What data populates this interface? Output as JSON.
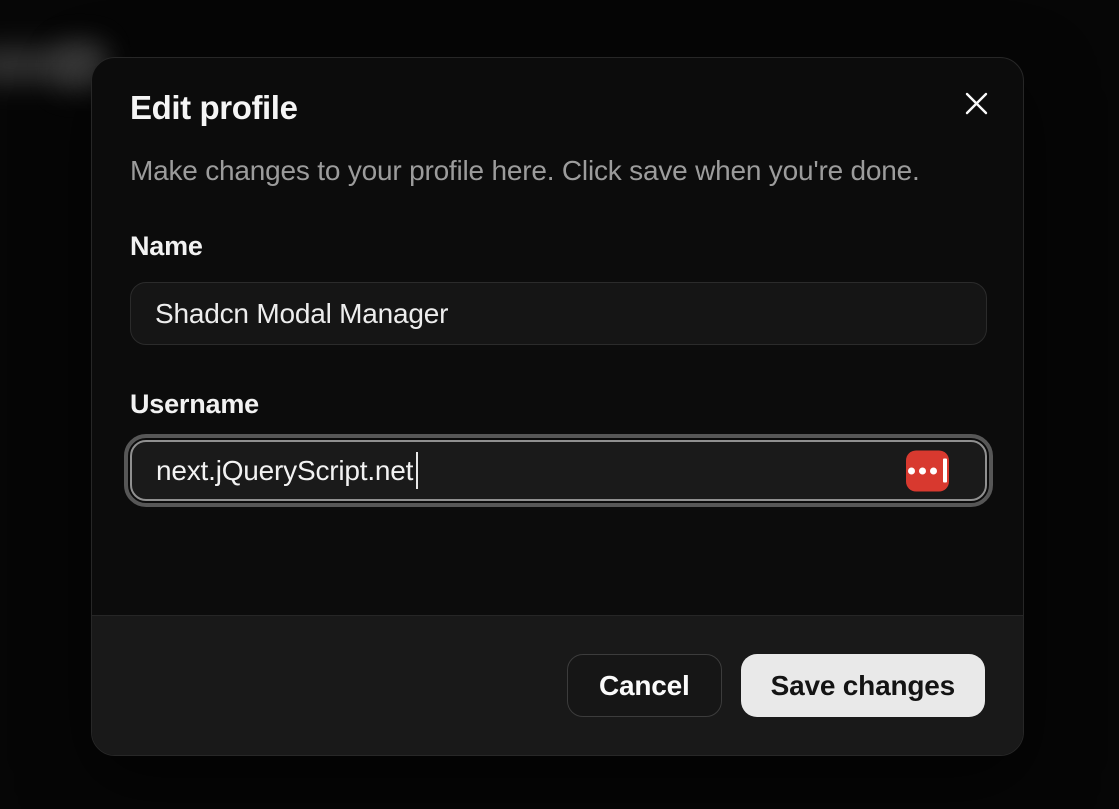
{
  "dialog": {
    "title": "Edit profile",
    "description": "Make changes to your profile here. Click save when you're done.",
    "fields": [
      {
        "label": "Name",
        "value": "Shadcn Modal Manager",
        "state": "default"
      },
      {
        "label": "Username",
        "value": "next.jQueryScript.net",
        "state": "focused",
        "adornment_icon": "lastpass-icon"
      }
    ],
    "footer": {
      "cancel_label": "Cancel",
      "save_label": "Save changes"
    },
    "close_icon": "x-icon"
  },
  "colors": {
    "dialog_bg": "#0c0c0c",
    "footer_bg": "#191919",
    "description_text": "#9c9c9c",
    "save_button_bg": "#e9e9e9",
    "lastpass_red": "#d8392f",
    "focus_ring": "#969696"
  }
}
